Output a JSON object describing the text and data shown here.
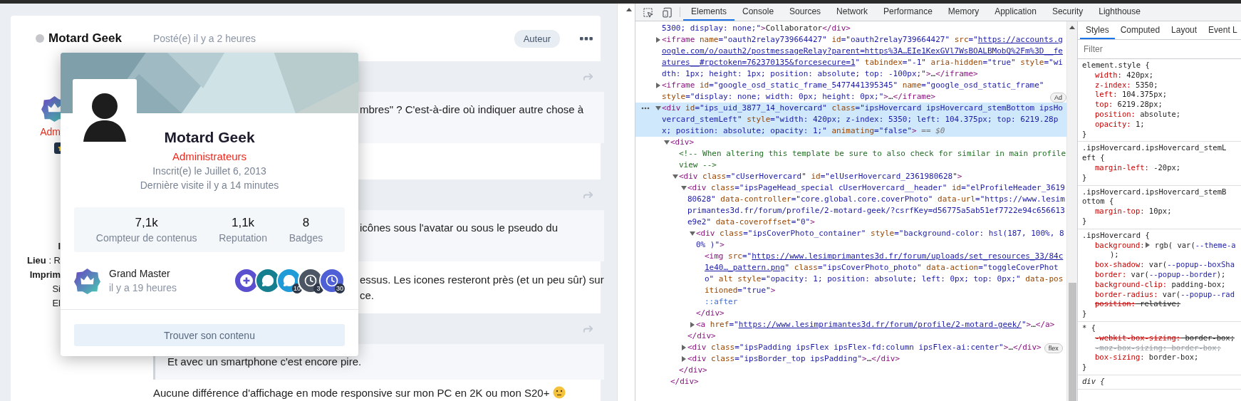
{
  "page": {
    "post": {
      "author": "Motard Geek",
      "online": false,
      "posted": "Posté(e) il y a 2 heures",
      "badge": "Auteur"
    },
    "author_panel": {
      "group": "Adm",
      "lines": [
        {
          "kind": "bold",
          "text": "I"
        },
        {
          "kind": "field",
          "text": "**Lieu** : R"
        },
        {
          "kind": "bold",
          "text": "Imprim"
        },
        {
          "kind": "plain",
          "text": "Si"
        },
        {
          "kind": "plain",
          "text": "El"
        }
      ]
    },
    "blocks": [
      {
        "kind": "quote",
        "covered": true,
        "trailing_emoji": false,
        "lines": [
          "mbres\" ? C'est-à-dire où indiquer autre chose à"
        ]
      },
      {
        "kind": "quote",
        "covered": true,
        "trailing_emoji": false,
        "lines": [
          "icônes sous l'avatar ou sous le pseudo du"
        ]
      },
      {
        "kind": "paragraph",
        "covered": true,
        "trailing_emoji": false,
        "lines": [
          "essus. Les icones resteront près (et un peu sûr) sur",
          "ce."
        ]
      },
      {
        "kind": "quote",
        "covered": false,
        "trailing_emoji": false,
        "lines": [
          "Et avec un smartphone c'est encore pire."
        ]
      },
      {
        "kind": "paragraph",
        "covered": false,
        "trailing_emoji": true,
        "lines": [
          "Aucune différence d'affichage en mode responsive sur mon PC en 2K ou mon S20+"
        ]
      }
    ],
    "hovercard": {
      "name": "Motard Geek",
      "group": "Administrateurs",
      "joined": "Inscrit(e) le Juillet 6, 2013",
      "last_visit": "Dernière visite il y a 14 minutes",
      "stats": [
        {
          "value": "7,1k",
          "label": "Compteur de contenus"
        },
        {
          "value": "1,1k",
          "label": "Reputation"
        },
        {
          "value": "8",
          "label": "Badges"
        }
      ],
      "rank": {
        "title": "Grand Master",
        "time": "il y a 19 heures"
      },
      "badges": [
        {
          "kind": "plus",
          "color": "#5a4fcf"
        },
        {
          "kind": "comment",
          "color": "#167f8f"
        },
        {
          "kind": "comment",
          "color": "#1f9bd7",
          "count": "10"
        },
        {
          "kind": "clock",
          "color": "#4b5563",
          "count": "3"
        },
        {
          "kind": "clock",
          "color": "#4f5fd6",
          "count": "30"
        }
      ],
      "button": "Trouver son contenu"
    }
  },
  "devtools": {
    "tabs": [
      {
        "label": "Elements",
        "selected": true
      },
      {
        "label": "Console",
        "selected": false
      },
      {
        "label": "Sources",
        "selected": false
      },
      {
        "label": "Network",
        "selected": false
      },
      {
        "label": "Performance",
        "selected": false
      },
      {
        "label": "Memory",
        "selected": false
      },
      {
        "label": "Application",
        "selected": false
      },
      {
        "label": "Security",
        "selected": false
      },
      {
        "label": "Lighthouse",
        "selected": false
      }
    ],
    "elements": [
      {
        "kind": "line",
        "selected": false,
        "parts": [
          {
            "kind": "value",
            "text": "5300; display: none;\""
          },
          {
            "kind": "tag",
            "text": ">"
          },
          {
            "kind": "text",
            "text": "Collaborator"
          },
          {
            "kind": "tag",
            "text": "</div>"
          }
        ]
      },
      {
        "kind": "element",
        "selected": false,
        "expanded": false,
        "parts": [
          {
            "kind": "tag",
            "text": "<iframe"
          },
          {
            "kind": "attr",
            "text": " name"
          },
          {
            "kind": "value",
            "text": "=\"oauth2relay739664427\""
          },
          {
            "kind": "attr",
            "text": " id"
          },
          {
            "kind": "value",
            "text": "=\"oauth2relay739664427\""
          },
          {
            "kind": "attr",
            "text": " src"
          },
          {
            "kind": "value",
            "text": "=\""
          },
          {
            "kind": "link",
            "text": "https://accounts.google.com/o/oauth2/postmessageRelay?parent=https%3A…EIe1KexGVl7WsBOALBMobQ%2Fm%3D__features__#rpctoken=762370135&forcesecure=1"
          },
          {
            "kind": "value",
            "text": "\""
          },
          {
            "kind": "attr",
            "text": " tabindex"
          },
          {
            "kind": "value",
            "text": "=\"-1\""
          },
          {
            "kind": "attr",
            "text": " aria-hidden"
          },
          {
            "kind": "value",
            "text": "=\"true\""
          },
          {
            "kind": "attr",
            "text": " style"
          },
          {
            "kind": "value",
            "text": "=\"width: 1px; height: 1px; position: absolute; top: -100px;\""
          },
          {
            "kind": "tag",
            "text": ">"
          },
          {
            "kind": "text",
            "text": "…"
          },
          {
            "kind": "tag",
            "text": "</iframe>"
          }
        ]
      },
      {
        "kind": "element",
        "selected": false,
        "expanded": false,
        "badge": "Ad",
        "parts": [
          {
            "kind": "tag",
            "text": "<iframe"
          },
          {
            "kind": "attr",
            "text": " id"
          },
          {
            "kind": "value",
            "text": "=\"google_osd_static_frame_5477441395345\""
          },
          {
            "kind": "attr",
            "text": " name"
          },
          {
            "kind": "value",
            "text": "=\"google_osd_static_frame\""
          },
          {
            "kind": "attr",
            "text": " style"
          },
          {
            "kind": "value",
            "text": "=\"display: none; width: 0px; height: 0px;\""
          },
          {
            "kind": "tag",
            "text": ">"
          },
          {
            "kind": "text",
            "text": "…"
          },
          {
            "kind": "tag",
            "text": "</iframe>"
          }
        ]
      },
      {
        "kind": "element",
        "selected": true,
        "expanded": true,
        "parts": [
          {
            "kind": "tag",
            "text": "<div"
          },
          {
            "kind": "attr",
            "text": " id"
          },
          {
            "kind": "value",
            "text": "=\"ips_uid_3877_14_hovercard\""
          },
          {
            "kind": "attr",
            "text": " class"
          },
          {
            "kind": "value",
            "text": "=\"ipsHovercard ipsHovercard_stemBottom ipsHovercard_stemLeft\""
          },
          {
            "kind": "attr",
            "text": " style"
          },
          {
            "kind": "value",
            "text": "=\"width: 420px; z-index: 5350; left: 104.375px; top: 6219.28px; position: absolute; opacity: 1;\""
          },
          {
            "kind": "attr",
            "text": " animating"
          },
          {
            "kind": "value",
            "text": "=\"false\""
          },
          {
            "kind": "tag",
            "text": ">"
          },
          {
            "kind": "ref",
            "text": " == $0"
          }
        ],
        "children": [
          {
            "kind": "element",
            "selected": false,
            "expanded": true,
            "parts": [
              {
                "kind": "tag",
                "text": "<div>"
              }
            ],
            "closing": [
              {
                "kind": "tag",
                "text": "</div>"
              }
            ],
            "children": [
              {
                "kind": "line",
                "selected": false,
                "parts": [
                  {
                    "kind": "comment",
                    "text": "<!-- When altering this template be sure to also check for similar in main profile view -->"
                  }
                ]
              },
              {
                "kind": "element",
                "selected": false,
                "expanded": true,
                "parts": [
                  {
                    "kind": "tag",
                    "text": "<div"
                  },
                  {
                    "kind": "attr",
                    "text": " class"
                  },
                  {
                    "kind": "value",
                    "text": "=\"cUserHovercard\""
                  },
                  {
                    "kind": "attr",
                    "text": " id"
                  },
                  {
                    "kind": "value",
                    "text": "=\"elUserHovercard_2361980628\""
                  },
                  {
                    "kind": "tag",
                    "text": ">"
                  }
                ],
                "closing": [
                  {
                    "kind": "tag",
                    "text": "</div>"
                  }
                ],
                "children": [
                  {
                    "kind": "element",
                    "selected": false,
                    "expanded": true,
                    "parts": [
                      {
                        "kind": "tag",
                        "text": "<div"
                      },
                      {
                        "kind": "attr",
                        "text": " class"
                      },
                      {
                        "kind": "value",
                        "text": "=\"ipsPageHead_special cUserHovercard__header\""
                      },
                      {
                        "kind": "attr",
                        "text": " id"
                      },
                      {
                        "kind": "value",
                        "text": "=\"elProfileHeader_361980628\""
                      },
                      {
                        "kind": "attr",
                        "text": " data-controller"
                      },
                      {
                        "kind": "value",
                        "text": "=\"core.global.core.coverPhoto\""
                      },
                      {
                        "kind": "attr",
                        "text": " data-url"
                      },
                      {
                        "kind": "value",
                        "text": "=\"https://www.lesimprimantes3d.fr/forum/profile/2-motard-geek/?csrfKey=d56775a5ab51ef7722e94c656613e9e2\""
                      },
                      {
                        "kind": "attr",
                        "text": " data-coveroffset"
                      },
                      {
                        "kind": "value",
                        "text": "=\"0\""
                      },
                      {
                        "kind": "tag",
                        "text": ">"
                      }
                    ],
                    "closing": [
                      {
                        "kind": "tag",
                        "text": "</div>"
                      }
                    ],
                    "children": [
                      {
                        "kind": "element",
                        "selected": false,
                        "expanded": true,
                        "parts": [
                          {
                            "kind": "tag",
                            "text": "<div"
                          },
                          {
                            "kind": "attr",
                            "text": " class"
                          },
                          {
                            "kind": "value",
                            "text": "=\"ipsCoverPhoto_container\""
                          },
                          {
                            "kind": "attr",
                            "text": " style"
                          },
                          {
                            "kind": "value",
                            "text": "=\"background-color: hsl(187, 100%, 80% )\""
                          },
                          {
                            "kind": "tag",
                            "text": ">"
                          }
                        ],
                        "closing": [
                          {
                            "kind": "tag",
                            "text": "</div>"
                          }
                        ],
                        "children": [
                          {
                            "kind": "line",
                            "selected": false,
                            "parts": [
                              {
                                "kind": "tag",
                                "text": "<img"
                              },
                              {
                                "kind": "attr",
                                "text": " src"
                              },
                              {
                                "kind": "value",
                                "text": "=\""
                              },
                              {
                                "kind": "link",
                                "text": "https://www.lesimprimantes3d.fr/forum/uploads/set_resources_33/84c1e40…_pattern.png"
                              },
                              {
                                "kind": "value",
                                "text": "\""
                              },
                              {
                                "kind": "attr",
                                "text": " class"
                              },
                              {
                                "kind": "value",
                                "text": "=\"ipsCoverPhoto_photo\""
                              },
                              {
                                "kind": "attr",
                                "text": " data-action"
                              },
                              {
                                "kind": "value",
                                "text": "=\"toggleCoverPhoto\""
                              },
                              {
                                "kind": "attr",
                                "text": " alt style"
                              },
                              {
                                "kind": "value",
                                "text": "=\"opacity: 1; position: absolute; left: 0px; top: 0px;\""
                              },
                              {
                                "kind": "attr",
                                "text": " data-positioned"
                              },
                              {
                                "kind": "value",
                                "text": "=\"true\""
                              },
                              {
                                "kind": "tag",
                                "text": ">"
                              }
                            ]
                          },
                          {
                            "kind": "line",
                            "selected": false,
                            "parts": [
                              {
                                "kind": "pseudo",
                                "text": "::after"
                              }
                            ]
                          }
                        ]
                      },
                      {
                        "kind": "element",
                        "selected": false,
                        "expanded": false,
                        "parts": [
                          {
                            "kind": "tag",
                            "text": "<a"
                          },
                          {
                            "kind": "attr",
                            "text": " href"
                          },
                          {
                            "kind": "value",
                            "text": "=\""
                          },
                          {
                            "kind": "link",
                            "text": "https://www.lesimprimantes3d.fr/forum/profile/2-motard-geek/"
                          },
                          {
                            "kind": "value",
                            "text": "\""
                          },
                          {
                            "kind": "tag",
                            "text": ">"
                          },
                          {
                            "kind": "text",
                            "text": "…"
                          },
                          {
                            "kind": "tag",
                            "text": "</a>"
                          }
                        ]
                      }
                    ]
                  },
                  {
                    "kind": "element",
                    "selected": false,
                    "expanded": false,
                    "badge": "flex",
                    "parts": [
                      {
                        "kind": "tag",
                        "text": "<div"
                      },
                      {
                        "kind": "attr",
                        "text": " class"
                      },
                      {
                        "kind": "value",
                        "text": "=\"ipsPadding ipsFlex ipsFlex-fd:column ipsFlex-ai:center\""
                      },
                      {
                        "kind": "tag",
                        "text": ">"
                      },
                      {
                        "kind": "text",
                        "text": "…"
                      },
                      {
                        "kind": "tag",
                        "text": "</div>"
                      }
                    ]
                  },
                  {
                    "kind": "element",
                    "selected": false,
                    "expanded": false,
                    "parts": [
                      {
                        "kind": "tag",
                        "text": "<div"
                      },
                      {
                        "kind": "attr",
                        "text": " class"
                      },
                      {
                        "kind": "value",
                        "text": "=\"ipsBorder_top ipsPadding\""
                      },
                      {
                        "kind": "tag",
                        "text": ">"
                      },
                      {
                        "kind": "text",
                        "text": "…"
                      },
                      {
                        "kind": "tag",
                        "text": "</div>"
                      }
                    ]
                  }
                ]
              }
            ]
          }
        ]
      }
    ],
    "styles": {
      "tabs": [
        {
          "label": "Styles",
          "selected": true
        },
        {
          "label": "Computed",
          "selected": false
        },
        {
          "label": "Layout",
          "selected": false
        },
        {
          "label": "Event L",
          "selected": false
        }
      ],
      "filter": {
        "placeholder": "Filter"
      },
      "rules": [
        {
          "selector": "element.style {",
          "user_agent": false,
          "close": "}",
          "properties": [
            {
              "name": "width:",
              "value": [
                {
                  "kind": "plain",
                  "text": " 420px;"
                }
              ],
              "expandable": false,
              "struck": false,
              "inactive": false
            },
            {
              "name": "z-index:",
              "value": [
                {
                  "kind": "plain",
                  "text": " 5350;"
                }
              ],
              "expandable": false,
              "struck": false,
              "inactive": false
            },
            {
              "name": "left:",
              "value": [
                {
                  "kind": "plain",
                  "text": " 104.375px;"
                }
              ],
              "expandable": false,
              "struck": false,
              "inactive": false
            },
            {
              "name": "top:",
              "value": [
                {
                  "kind": "plain",
                  "text": " 6219.28px;"
                }
              ],
              "expandable": false,
              "struck": false,
              "inactive": false
            },
            {
              "name": "position:",
              "value": [
                {
                  "kind": "plain",
                  "text": " absolute;"
                }
              ],
              "expandable": false,
              "struck": false,
              "inactive": false
            },
            {
              "name": "opacity:",
              "value": [
                {
                  "kind": "plain",
                  "text": " 1;"
                }
              ],
              "expandable": false,
              "struck": false,
              "inactive": false
            }
          ]
        },
        {
          "selector": ".ipsHovercard.ipsHovercard_stemLeft {",
          "user_agent": false,
          "close": "}",
          "properties": [
            {
              "name": "margin-left:",
              "value": [
                {
                  "kind": "plain",
                  "text": " -20px;"
                }
              ],
              "expandable": false,
              "struck": false,
              "inactive": false
            }
          ]
        },
        {
          "selector": ".ipsHovercard.ipsHovercard_stemBottom {",
          "user_agent": false,
          "close": "}",
          "properties": [
            {
              "name": "margin-top:",
              "value": [
                {
                  "kind": "plain",
                  "text": " 10px;"
                }
              ],
              "expandable": false,
              "struck": false,
              "inactive": false
            }
          ]
        },
        {
          "selector": ".ipsHovercard {",
          "user_agent": false,
          "close": "}",
          "properties": [
            {
              "name": "background:",
              "value": [
                {
                  "kind": "plain",
                  "text": " rgb( var("
                },
                {
                  "kind": "var",
                  "text": "--theme-a"
                }
              ],
              "continued": ");",
              "expandable": true,
              "struck": false,
              "inactive": false
            },
            {
              "name": "box-shadow:",
              "value": [
                {
                  "kind": "plain",
                  "text": " var("
                },
                {
                  "kind": "var",
                  "text": "--popup--boxSha"
                }
              ],
              "expandable": false,
              "struck": false,
              "inactive": false
            },
            {
              "name": "border:",
              "value": [
                {
                  "kind": "plain",
                  "text": " var("
                },
                {
                  "kind": "var",
                  "text": "--popup--border"
                },
                {
                  "kind": "plain",
                  "text": ");"
                }
              ],
              "expandable": false,
              "struck": false,
              "inactive": false
            },
            {
              "name": "background-clip:",
              "value": [
                {
                  "kind": "plain",
                  "text": " padding-box;"
                }
              ],
              "expandable": false,
              "struck": false,
              "inactive": false
            },
            {
              "name": "border-radius:",
              "value": [
                {
                  "kind": "plain",
                  "text": " var("
                },
                {
                  "kind": "var",
                  "text": "--popup--rad"
                }
              ],
              "expandable": false,
              "struck": false,
              "inactive": false
            },
            {
              "name": "position:",
              "value": [
                {
                  "kind": "plain",
                  "text": " relative;"
                }
              ],
              "expandable": false,
              "struck": true,
              "inactive": false
            }
          ]
        },
        {
          "selector": "* {",
          "user_agent": false,
          "close": "}",
          "properties": [
            {
              "name": "-webkit-box-sizing:",
              "value": [
                {
                  "kind": "plain",
                  "text": " border-box;"
                }
              ],
              "expandable": false,
              "struck": true,
              "inactive": false
            },
            {
              "name": "-moz-box-sizing:",
              "value": [
                {
                  "kind": "plain",
                  "text": " border-box;"
                }
              ],
              "expandable": false,
              "struck": true,
              "inactive": true
            },
            {
              "name": "box-sizing:",
              "value": [
                {
                  "kind": "plain",
                  "text": " border-box;"
                }
              ],
              "expandable": false,
              "struck": false,
              "inactive": false
            }
          ]
        },
        {
          "selector": "div {",
          "user_agent": true
        }
      ]
    }
  }
}
